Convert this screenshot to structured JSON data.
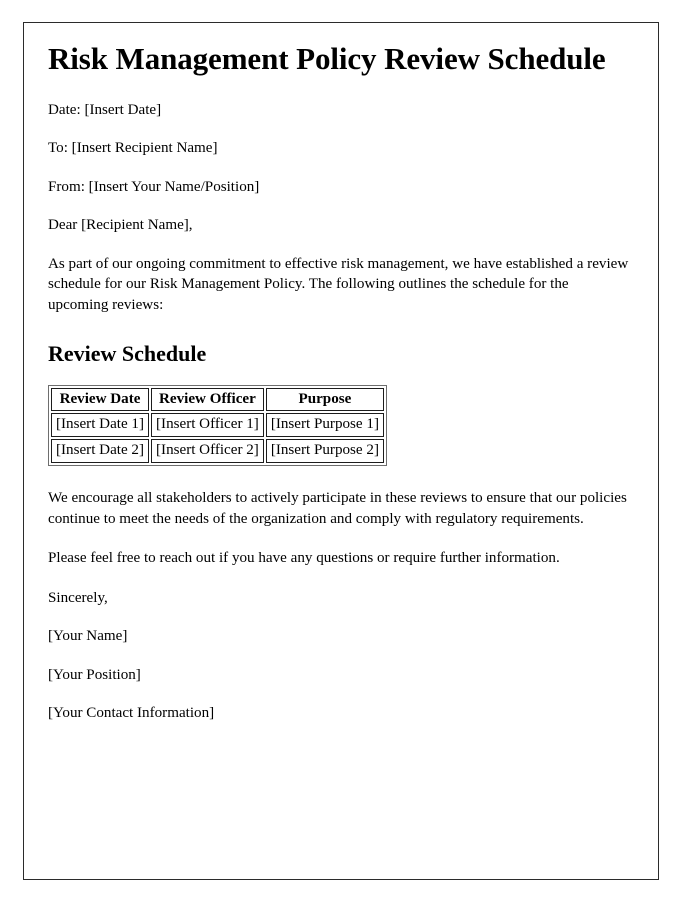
{
  "document": {
    "title": "Risk Management Policy Review Schedule",
    "meta": {
      "date_line": "Date: [Insert Date]",
      "to_line": "To: [Insert Recipient Name]",
      "from_line": "From: [Insert Your Name/Position]"
    },
    "salutation": "Dear [Recipient Name],",
    "intro_paragraph": "As part of our ongoing commitment to effective risk management, we have established a review schedule for our Risk Management Policy. The following outlines the schedule for the upcoming reviews:",
    "section_heading": "Review Schedule",
    "schedule_table": {
      "headers": [
        "Review Date",
        "Review Officer",
        "Purpose"
      ],
      "rows": [
        [
          "[Insert Date 1]",
          "[Insert Officer 1]",
          "[Insert Purpose 1]"
        ],
        [
          "[Insert Date 2]",
          "[Insert Officer 2]",
          "[Insert Purpose 2]"
        ]
      ]
    },
    "closing_paragraph": "We encourage all stakeholders to actively participate in these reviews to ensure that our policies continue to meet the needs of the organization and comply with regulatory requirements.",
    "followup_paragraph": "Please feel free to reach out if you have any questions or require further information.",
    "signoff": {
      "closing": "Sincerely,",
      "name": "[Your Name]",
      "position": "[Your Position]",
      "contact": "[Your Contact Information]"
    }
  },
  "style": {
    "page_background": "#ffffff",
    "page_border_color": "#2b2b2b",
    "text_color": "#000000",
    "table_border_color": "#1d1d1d",
    "table_outer_border_color": "#6e6e6e"
  }
}
